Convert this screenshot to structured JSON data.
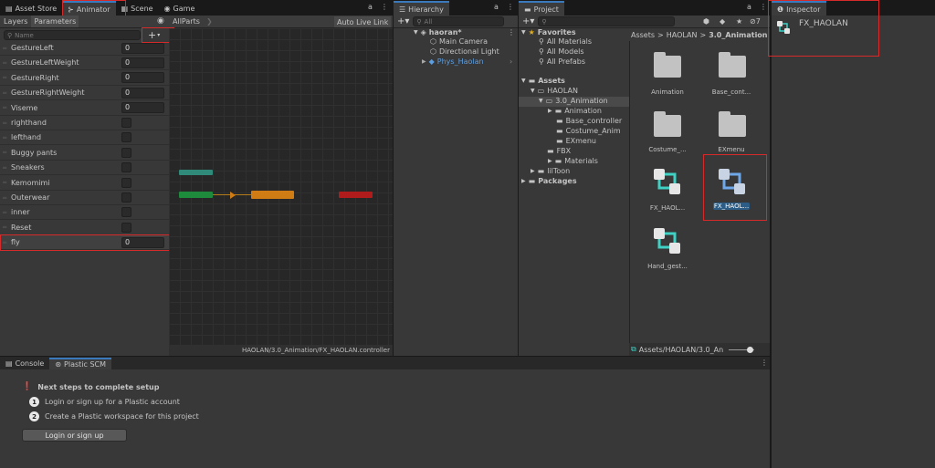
{
  "animator_window": {
    "tabs": [
      {
        "label": "Asset Store"
      },
      {
        "label": "Animator"
      },
      {
        "label": "Scene"
      },
      {
        "label": "Game"
      }
    ],
    "subtabs": {
      "layers": "Layers",
      "parameters": "Parameters"
    },
    "breadcrumb": "AllParts",
    "auto_live_link": "Auto Live Link",
    "search_placeholder": "Name",
    "add_button": "+",
    "parameters": [
      {
        "name": "GestureLeft",
        "type": "int",
        "value": "0"
      },
      {
        "name": "GestureLeftWeight",
        "type": "float",
        "value": "0"
      },
      {
        "name": "GestureRight",
        "type": "int",
        "value": "0"
      },
      {
        "name": "GestureRightWeight",
        "type": "float",
        "value": "0"
      },
      {
        "name": "Viseme",
        "type": "int",
        "value": "0"
      },
      {
        "name": "righthand",
        "type": "bool"
      },
      {
        "name": "lefthand",
        "type": "bool"
      },
      {
        "name": "Buggy pants",
        "type": "bool"
      },
      {
        "name": "Sneakers",
        "type": "bool"
      },
      {
        "name": "Kemomimi",
        "type": "bool"
      },
      {
        "name": "Outerwear",
        "type": "bool"
      },
      {
        "name": "inner",
        "type": "bool"
      },
      {
        "name": "Reset",
        "type": "bool"
      },
      {
        "name": "fly",
        "type": "int",
        "value": "0"
      }
    ],
    "graph_path": "HAOLAN/3.0_Animation/FX_HAOLAN.controller",
    "colors": {
      "entry_node": "#1e8a3c",
      "default_node": "#d07c14",
      "exit_node": "#b01c1c",
      "anystate_node": "#2f8a7a"
    }
  },
  "hierarchy": {
    "tab": "Hierarchy",
    "search_placeholder": "All",
    "scene": "haoran*",
    "items": [
      {
        "label": "Main Camera"
      },
      {
        "label": "Directional Light"
      },
      {
        "label": "Phys_Haolan"
      }
    ]
  },
  "project": {
    "tab": "Project",
    "favorites": {
      "label": "Favorites",
      "items": [
        "All Materials",
        "All Models",
        "All Prefabs"
      ]
    },
    "assets_tree": {
      "assets": "Assets",
      "haolan": "HAOLAN",
      "animation_folder": "3.0_Animation",
      "children": [
        "Animation",
        "Base_controller",
        "Costume_Anim",
        "EXmenu"
      ],
      "siblings": [
        "FBX",
        "Materials"
      ],
      "liltoon": "lilToon",
      "packages": "Packages"
    },
    "breadcrumb": [
      "Assets",
      "HAOLAN",
      "3.0_Animation"
    ],
    "breadcrumb_sep": ">",
    "badge_count": "7",
    "assets": [
      {
        "label": "Animation",
        "kind": "folder"
      },
      {
        "label": "Base_cont...",
        "kind": "folder"
      },
      {
        "label": "Costume_...",
        "kind": "folder"
      },
      {
        "label": "EXmenu",
        "kind": "folder"
      },
      {
        "label": "FX_HAOL...",
        "kind": "controller"
      },
      {
        "label": "FX_HAOL...",
        "kind": "controller",
        "selected": true
      },
      {
        "label": "Hand_gest...",
        "kind": "controller"
      }
    ],
    "footer_path": "Assets/HAOLAN/3.0_An"
  },
  "inspector": {
    "tab": "Inspector",
    "object_name": "FX_HAOLAN"
  },
  "console_area": {
    "tabs": [
      "Console",
      "Plastic SCM"
    ],
    "heading": "Next steps to complete setup",
    "steps": [
      {
        "num": "1",
        "text": "Login or sign up for a Plastic account"
      },
      {
        "num": "2",
        "text": "Create a Plastic workspace for this project"
      }
    ],
    "login_button": "Login or sign up"
  }
}
